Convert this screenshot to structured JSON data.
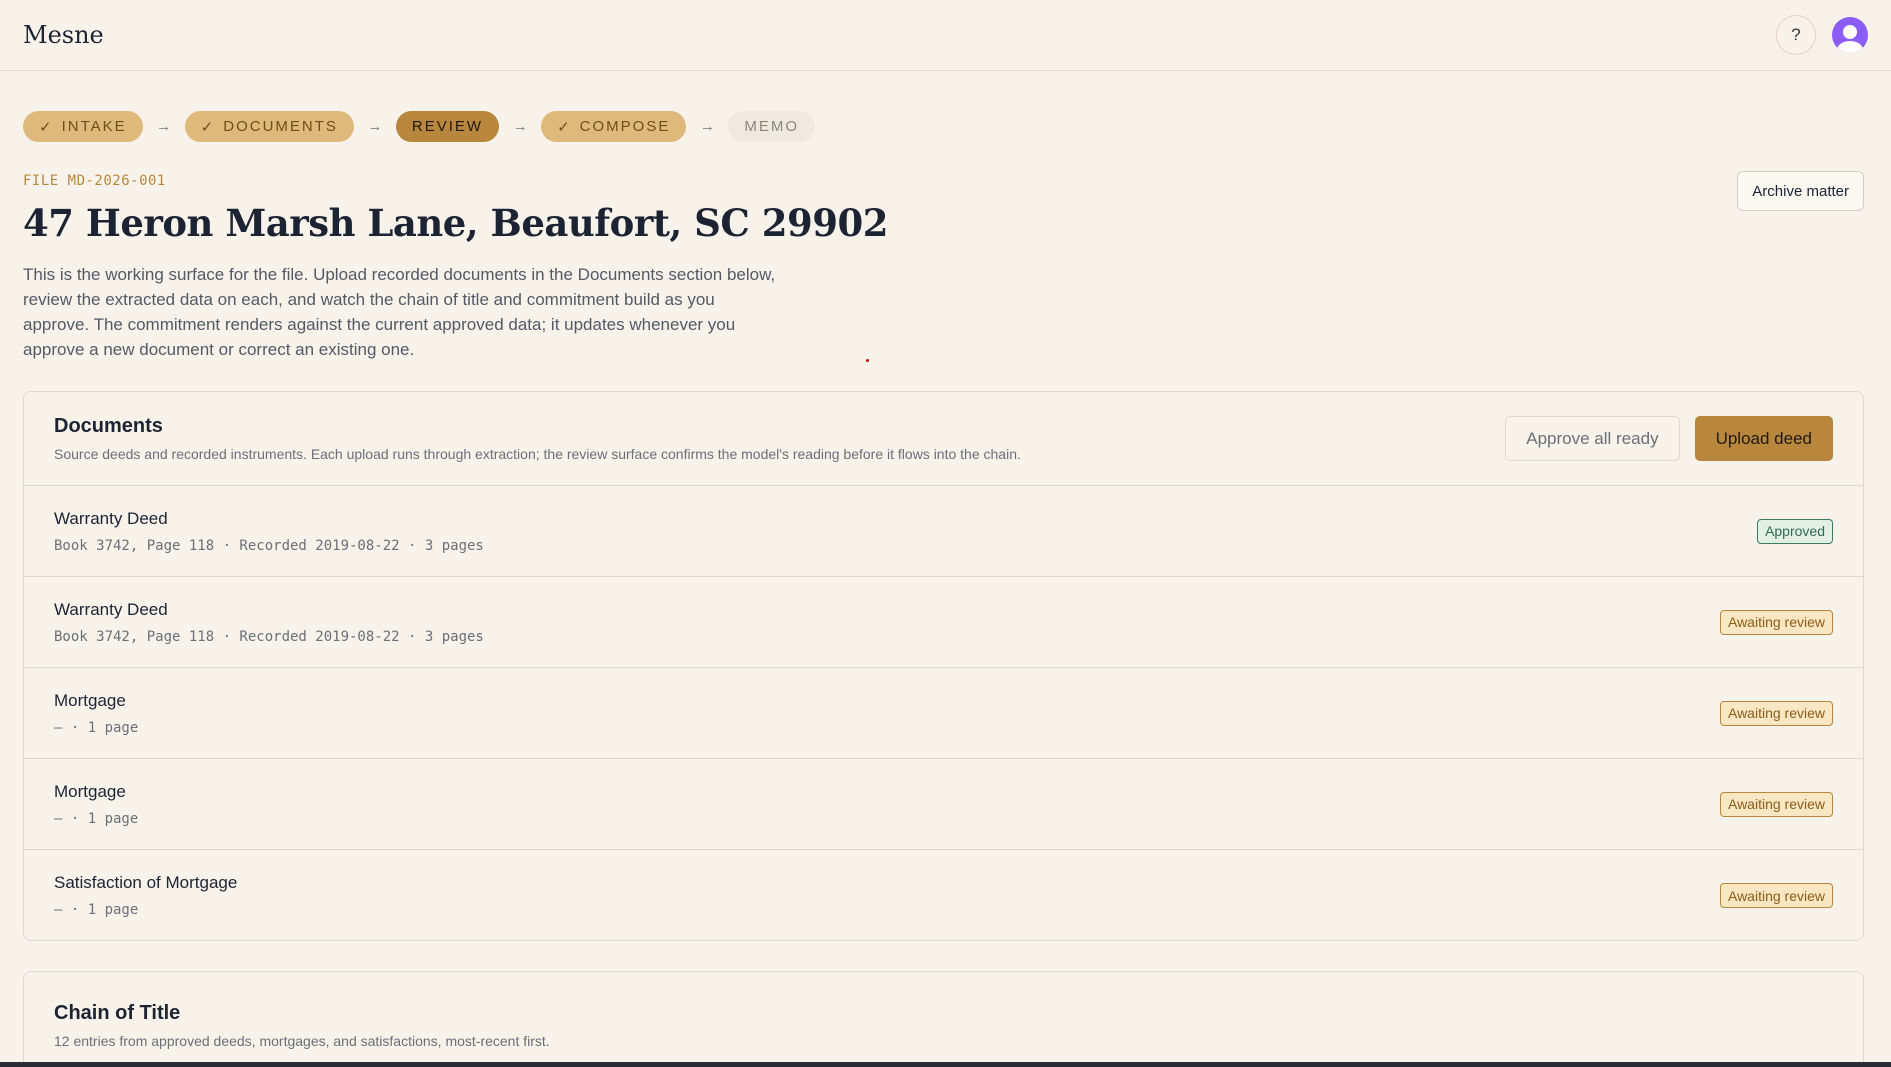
{
  "app": {
    "brand": "Mesne",
    "help_label": "?"
  },
  "steps": [
    {
      "check": "✓",
      "label": "INTAKE",
      "state": "done"
    },
    {
      "check": "✓",
      "label": "DOCUMENTS",
      "state": "done"
    },
    {
      "check": "",
      "label": "REVIEW",
      "state": "active"
    },
    {
      "check": "✓",
      "label": "COMPOSE",
      "state": "done"
    },
    {
      "check": "",
      "label": "MEMO",
      "state": "pending"
    }
  ],
  "file": {
    "id": "FILE MD-2026-001",
    "title": "47 Heron Marsh Lane, Beaufort, SC 29902",
    "intro": "This is the working surface for the file. Upload recorded documents in the Documents section below, review the extracted data on each, and watch the chain of title and commitment build as you approve. The commitment renders against the current approved data; it updates whenever you approve a new document or correct an existing one.",
    "archive_label": "Archive matter"
  },
  "documents": {
    "title": "Documents",
    "subtitle": "Source deeds and recorded instruments. Each upload runs through extraction; the review surface confirms the model's reading before it flows into the chain.",
    "approve_all_label": "Approve all ready",
    "upload_label": "Upload deed",
    "items": [
      {
        "name": "Warranty Deed",
        "meta": "Book 3742, Page 118 · Recorded 2019-08-22 · 3 pages",
        "status": "Approved",
        "status_kind": "approved"
      },
      {
        "name": "Warranty Deed",
        "meta": "Book 3742, Page 118 · Recorded 2019-08-22 · 3 pages",
        "status": "Awaiting review",
        "status_kind": "awaiting"
      },
      {
        "name": "Mortgage",
        "meta": "— · 1 page",
        "status": "Awaiting review",
        "status_kind": "awaiting"
      },
      {
        "name": "Mortgage",
        "meta": "— · 1 page",
        "status": "Awaiting review",
        "status_kind": "awaiting"
      },
      {
        "name": "Satisfaction of Mortgage",
        "meta": "— · 1 page",
        "status": "Awaiting review",
        "status_kind": "awaiting"
      }
    ]
  },
  "chain": {
    "title": "Chain of Title",
    "subtitle": "12 entries from approved deeds, mortgages, and satisfactions, most-recent first."
  },
  "colors": {
    "accent": "#b8873d",
    "step_done": "#dfb97b",
    "background": "#f8f3ea",
    "approved": "#2f6b4e",
    "avatar": "#8b5cf6"
  }
}
